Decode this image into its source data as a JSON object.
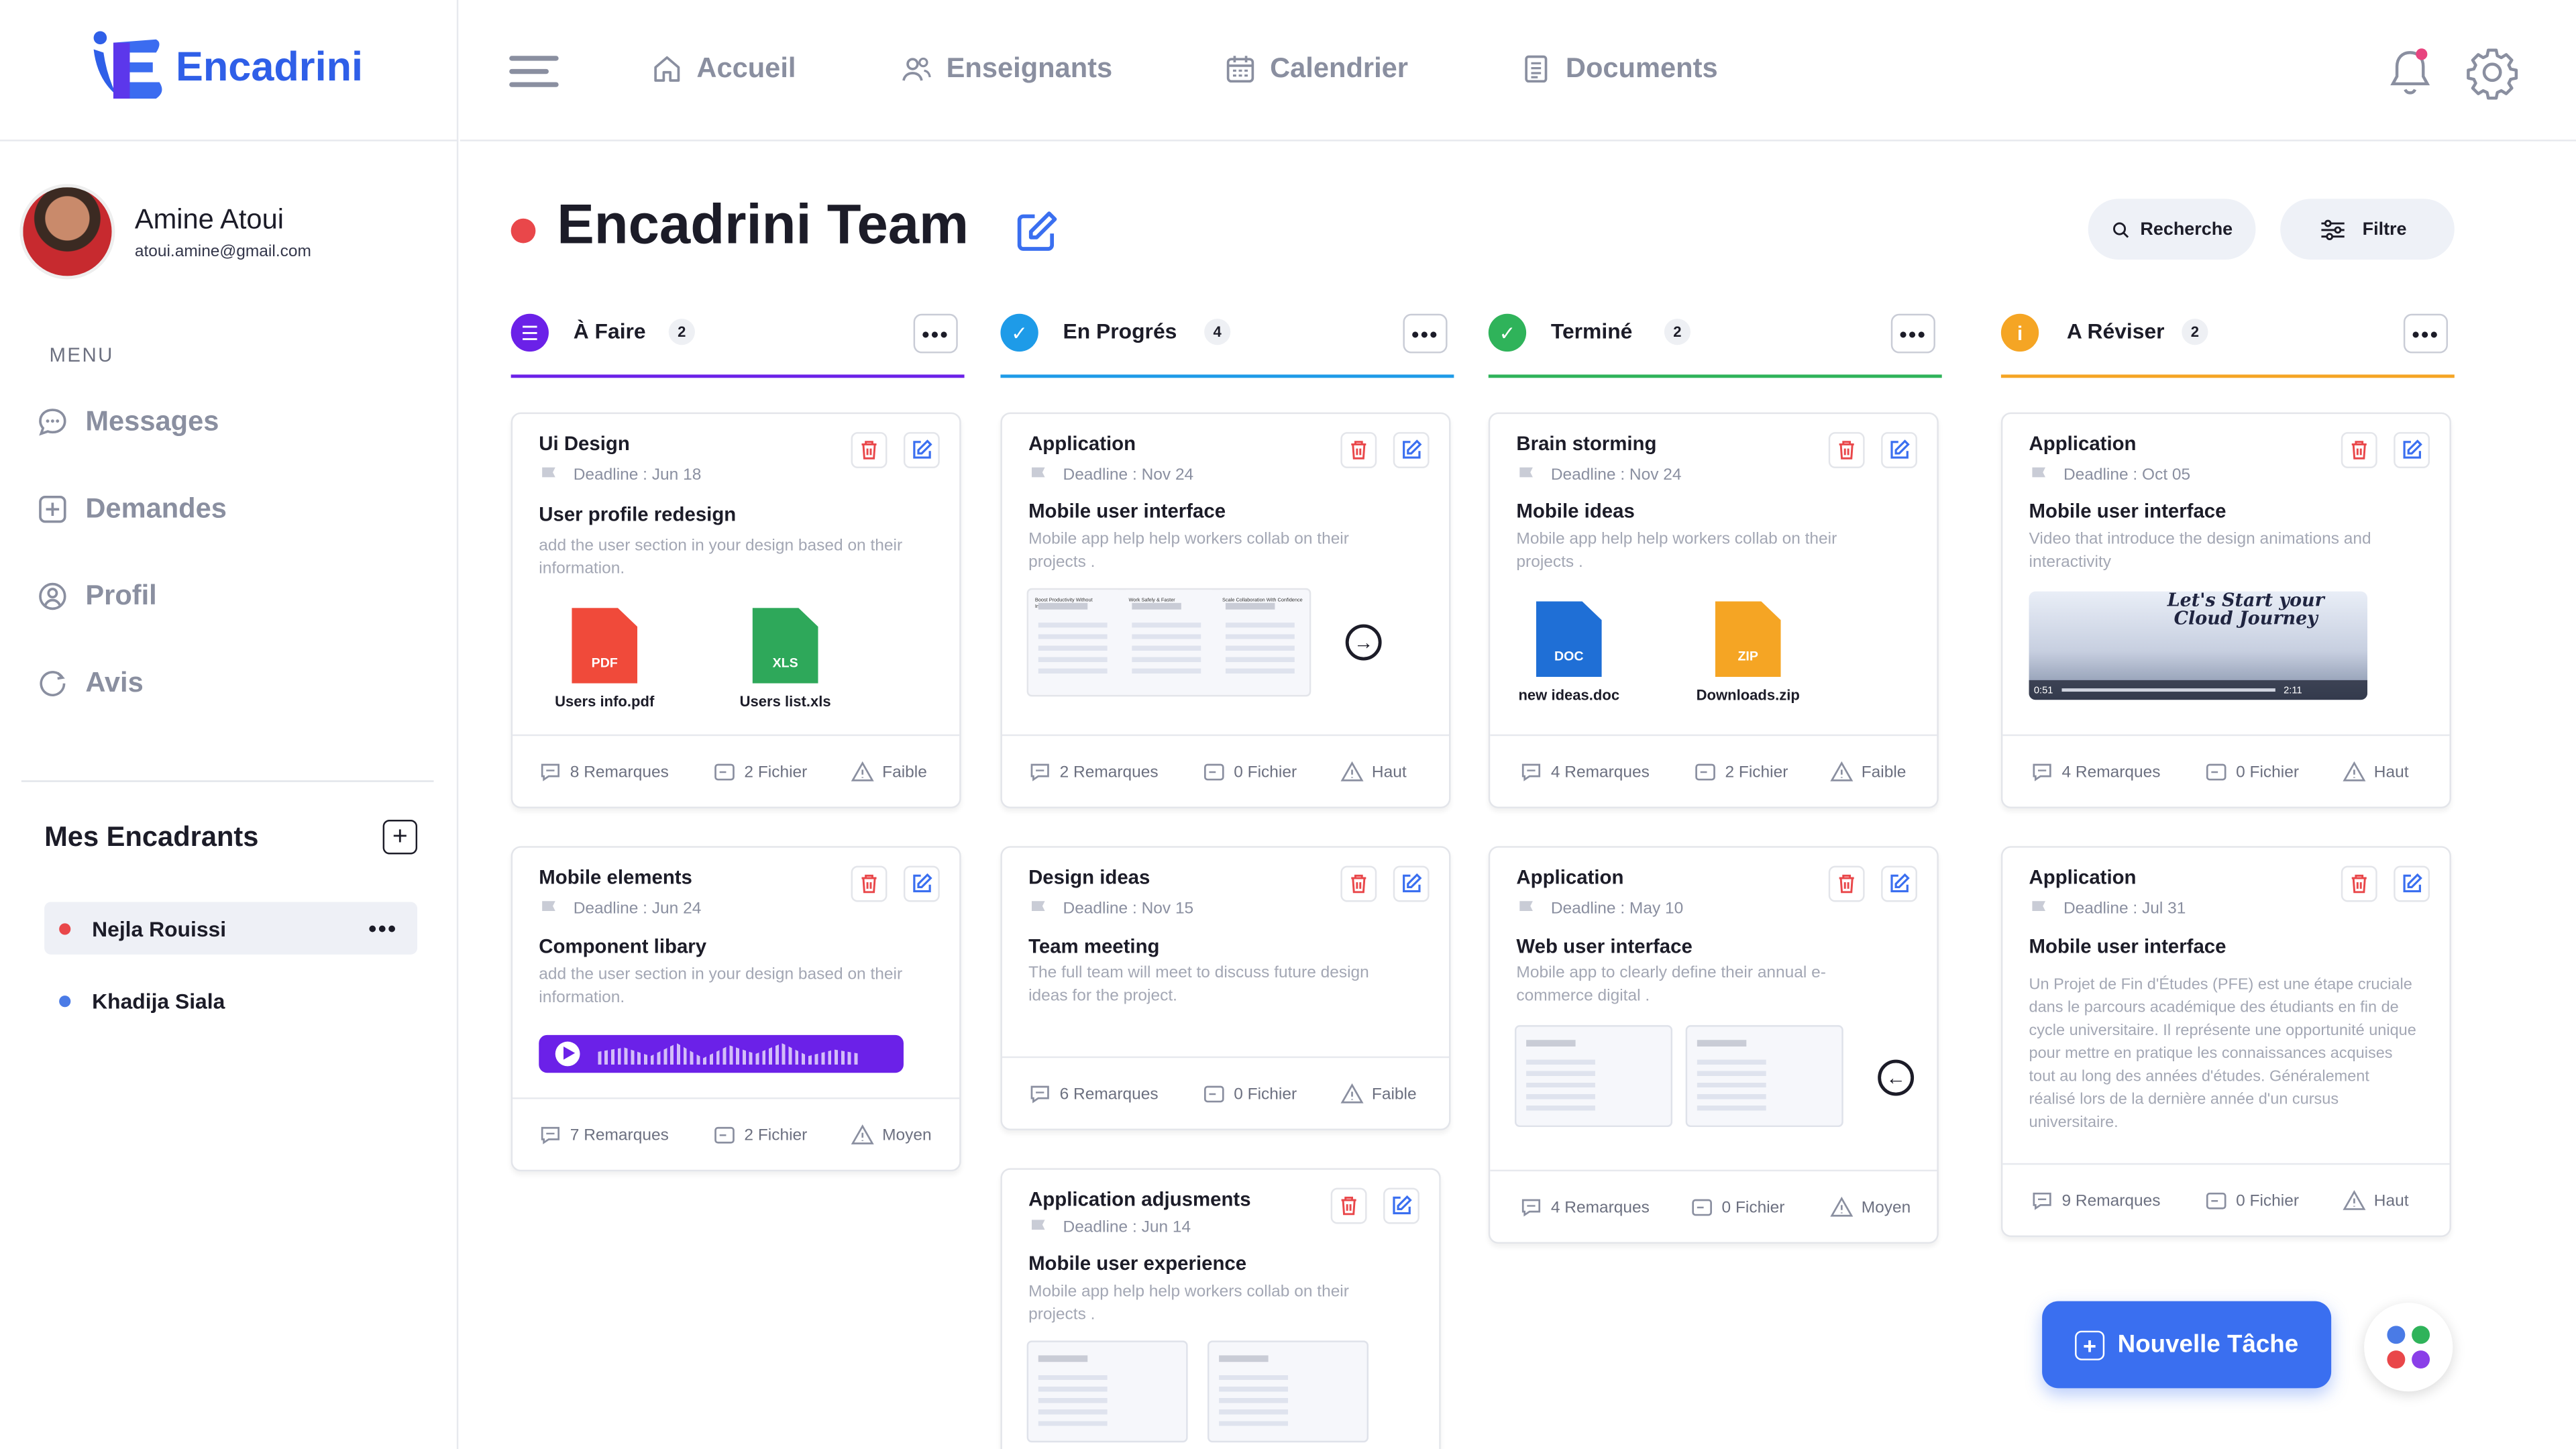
{
  "brand": {
    "name": "Encadrini"
  },
  "user": {
    "name": "Amine Atoui",
    "email": "atoui.amine@gmail.com"
  },
  "menu": {
    "label": "MENU",
    "items": [
      {
        "label": "Messages",
        "icon": "chat-icon"
      },
      {
        "label": "Demandes",
        "icon": "plus-square-icon"
      },
      {
        "label": "Profil",
        "icon": "user-circle-icon"
      },
      {
        "label": "Avis",
        "icon": "review-icon"
      }
    ]
  },
  "encadrants": {
    "title": "Mes Encadrants",
    "items": [
      {
        "name": "Nejla Rouissi",
        "color": "#e9474a",
        "active": true
      },
      {
        "name": "Khadija Siala",
        "color": "#4a7be6",
        "active": false
      }
    ]
  },
  "topnav": [
    {
      "label": "Accueil",
      "icon": "home-icon"
    },
    {
      "label": "Enseignants",
      "icon": "users-icon"
    },
    {
      "label": "Calendrier",
      "icon": "calendar-icon"
    },
    {
      "label": "Documents",
      "icon": "document-icon"
    }
  ],
  "board": {
    "title": "Encadrini Team",
    "search_label": "Recherche",
    "filter_label": "Filtre"
  },
  "columns": [
    {
      "title": "À Faire",
      "count": "2",
      "color": "#6b21e8",
      "icon": "list-icon"
    },
    {
      "title": "En Progrés",
      "count": "4",
      "color": "#1e9be8",
      "icon": "check-icon"
    },
    {
      "title": "Terminé",
      "count": "2",
      "color": "#2fb35a",
      "icon": "check-icon"
    },
    {
      "title": "A Réviser",
      "count": "2",
      "color": "#f5a524",
      "icon": "info-icon"
    }
  ],
  "cards": [
    {
      "category": "Ui Design",
      "deadline": "Deadline : Jun 18",
      "title": "User profile redesign",
      "desc": "add the user section in your design based on their information.",
      "remarks": "8 Remarques",
      "files": "2 Fichier",
      "priority": "Faible",
      "attachments": [
        "Users info.pdf",
        "Users list.xls"
      ]
    },
    {
      "category": "Mobile elements",
      "deadline": "Deadline : Jun 24",
      "title": "Component libary",
      "desc": "add the user section in your design based on their information.",
      "remarks": "7 Remarques",
      "files": "2 Fichier",
      "priority": "Moyen"
    },
    {
      "category": "Application",
      "deadline": "Deadline : Nov 24",
      "title": "Mobile user interface",
      "desc": "Mobile app help help workers collab on their projects .",
      "remarks": "2 Remarques",
      "files": "0 Fichier",
      "priority": "Haut",
      "thumb_labels": [
        "Boost Productivity Without Interruption",
        "Work Safely & Faster",
        "Scale Collaboration With Confidence"
      ]
    },
    {
      "category": "Design ideas",
      "deadline": "Deadline : Nov 15",
      "title": "Team meeting",
      "desc": "The full team will meet to discuss future design ideas for the project.",
      "remarks": "6 Remarques",
      "files": "0 Fichier",
      "priority": "Faible"
    },
    {
      "category": "Application adjusments",
      "deadline": "Deadline : Jun 14",
      "title": "Mobile user experience",
      "desc": "Mobile app help help workers collab on their projects ."
    },
    {
      "category": "Brain storming",
      "deadline": "Deadline : Nov 24",
      "title": "Mobile ideas",
      "desc": "Mobile app help help workers collab on their projects .",
      "remarks": "4 Remarques",
      "files": "2 Fichier",
      "priority": "Faible",
      "attachments": [
        "new ideas.doc",
        "Downloads.zip"
      ]
    },
    {
      "category": "Application",
      "deadline": "Deadline : May 10",
      "title": "Web user interface",
      "desc": "Mobile app to clearly define their annual e-commerce digital .",
      "remarks": "4 Remarques",
      "files": "0 Fichier",
      "priority": "Moyen"
    },
    {
      "category": "Application",
      "deadline": "Deadline : Oct 05",
      "title": "Mobile user interface",
      "desc": "Video that introduce the design animations and interactivity",
      "remarks": "4 Remarques",
      "files": "0 Fichier",
      "priority": "Haut",
      "video_title": "Let's Start your Cloud Journey",
      "video_time": "0:51",
      "video_duration": "2:11"
    },
    {
      "category": "Application",
      "deadline": "Deadline : Jul 31",
      "title": "Mobile user interface",
      "desc": "Un Projet de Fin d'Études (PFE) est une étape cruciale dans le parcours académique des étudiants en fin de cycle universitaire. Il représente une opportunité unique pour mettre en pratique les connaissances acquises tout au long des années d'études. Généralement réalisé lors de la dernière année d'un cursus universitaire.",
      "remarks": "9 Remarques",
      "files": "0 Fichier",
      "priority": "Haut"
    }
  ],
  "file_badges": {
    "pdf": "PDF",
    "xls": "XLS",
    "doc": "DOC",
    "zip": "ZIP"
  },
  "fab": {
    "label": "Nouvelle Tâche"
  }
}
